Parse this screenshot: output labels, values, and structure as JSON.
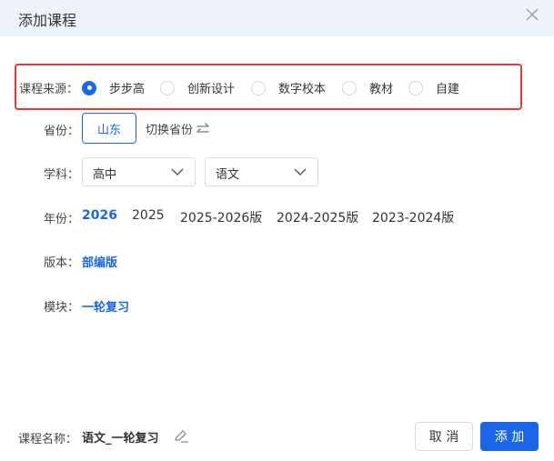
{
  "dialog": {
    "title": "添加课程"
  },
  "source": {
    "label": "课程来源：",
    "options": [
      "步步高",
      "创新设计",
      "数字校本",
      "教材",
      "自建"
    ],
    "selected": "步步高"
  },
  "province": {
    "label": "省份：",
    "value": "山东",
    "switch_label": "切换省份"
  },
  "subject": {
    "label": "学科：",
    "stage": "高中",
    "subject": "语文"
  },
  "year": {
    "label": "年份：",
    "options": [
      "2026",
      "2025",
      "2025-2026版",
      "2024-2025版",
      "2023-2024版"
    ],
    "selected": "2026"
  },
  "edition": {
    "label": "版本：",
    "value": "部编版"
  },
  "module": {
    "label": "模块：",
    "value": "一轮复习"
  },
  "footer": {
    "course_name_label": "课程名称：",
    "course_name": "语文_一轮复习",
    "cancel": "取 消",
    "add": "添 加"
  },
  "colors": {
    "accent": "#1a66e8",
    "highlight_border": "#e53935",
    "header_bg": "#eef2fb"
  }
}
